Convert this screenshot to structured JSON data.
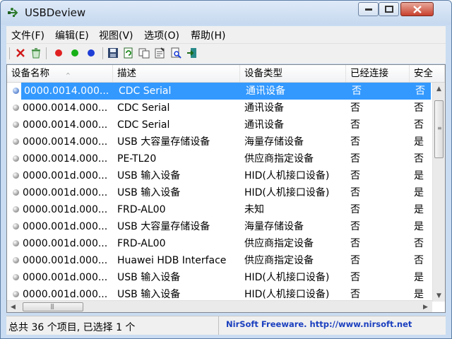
{
  "window": {
    "title": "USBDeview"
  },
  "menu": [
    "文件(F)",
    "编辑(E)",
    "视图(V)",
    "选项(O)",
    "帮助(H)"
  ],
  "toolbar": {
    "icons": [
      "delete-icon",
      "recycle-icon",
      "red-dot-icon",
      "green-dot-icon",
      "blue-dot-icon",
      "save-icon",
      "refresh-icon",
      "copy-icon",
      "properties-icon",
      "find-icon",
      "exit-icon"
    ],
    "colors": {
      "red": "#e02020",
      "green": "#18b018",
      "blue": "#1e3ed6"
    }
  },
  "columns": [
    "设备名称",
    "描述",
    "设备类型",
    "已经连接",
    "安全"
  ],
  "rows": [
    {
      "name": "0000.0014.000...",
      "desc": "CDC Serial",
      "type": "通讯设备",
      "connected": "否",
      "safe": "否",
      "selected": true
    },
    {
      "name": "0000.0014.000...",
      "desc": "CDC Serial",
      "type": "通讯设备",
      "connected": "否",
      "safe": "否"
    },
    {
      "name": "0000.0014.000...",
      "desc": "CDC Serial",
      "type": "通讯设备",
      "connected": "否",
      "safe": "否"
    },
    {
      "name": "0000.0014.000...",
      "desc": "USB 大容量存储设备",
      "type": "海量存储设备",
      "connected": "否",
      "safe": "是"
    },
    {
      "name": "0000.0014.000...",
      "desc": "PE-TL20",
      "type": "供应商指定设备",
      "connected": "否",
      "safe": "否"
    },
    {
      "name": "0000.001d.000...",
      "desc": "USB 输入设备",
      "type": "HID(人机接口设备)",
      "connected": "否",
      "safe": "是"
    },
    {
      "name": "0000.001d.000...",
      "desc": "USB 输入设备",
      "type": "HID(人机接口设备)",
      "connected": "否",
      "safe": "是"
    },
    {
      "name": "0000.001d.000...",
      "desc": "FRD-AL00",
      "type": "未知",
      "connected": "否",
      "safe": "是"
    },
    {
      "name": "0000.001d.000...",
      "desc": "USB 大容量存储设备",
      "type": "海量存储设备",
      "connected": "否",
      "safe": "是"
    },
    {
      "name": "0000.001d.000...",
      "desc": "FRD-AL00",
      "type": "供应商指定设备",
      "connected": "否",
      "safe": "否"
    },
    {
      "name": "0000.001d.000...",
      "desc": "Huawei HDB Interface",
      "type": "供应商指定设备",
      "connected": "否",
      "safe": "否"
    },
    {
      "name": "0000.001d.000...",
      "desc": "USB 输入设备",
      "type": "HID(人机接口设备)",
      "connected": "否",
      "safe": "是"
    },
    {
      "name": "0000.001d.000...",
      "desc": "USB 输入设备",
      "type": "HID(人机接口设备)",
      "connected": "否",
      "safe": "是"
    }
  ],
  "status": {
    "summary": "总共 36 个项目, 已选择 1 个",
    "link": "NirSoft Freeware.  http://www.nirsoft.net"
  },
  "colors": {
    "selection": "#3399ff",
    "link": "#1a3fbf"
  }
}
